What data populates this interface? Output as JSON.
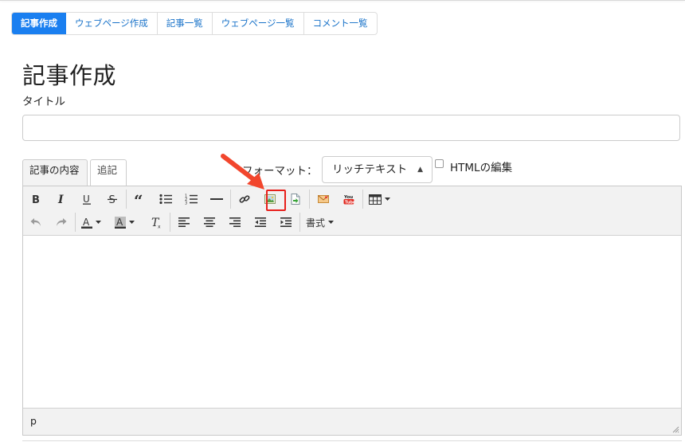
{
  "nav": {
    "tabs": [
      "記事作成",
      "ウェブページ作成",
      "記事一覧",
      "ウェブページ一覧",
      "コメント一覧"
    ],
    "active_index": 0
  },
  "page_title": "記事作成",
  "title_field": {
    "label": "タイトル",
    "value": ""
  },
  "content_tabs": [
    "記事の内容",
    "追記"
  ],
  "format": {
    "label": "フォーマット：",
    "selected": "リッチテキスト"
  },
  "html_edit": {
    "label": "HTMLの編集",
    "checked": false
  },
  "toolbar": {
    "format_menu_label": "書式"
  },
  "statusbar": {
    "path": "p"
  },
  "colors": {
    "accent": "#1a7ff0",
    "highlight": "#e8201b",
    "arrow": "#f2462d"
  }
}
